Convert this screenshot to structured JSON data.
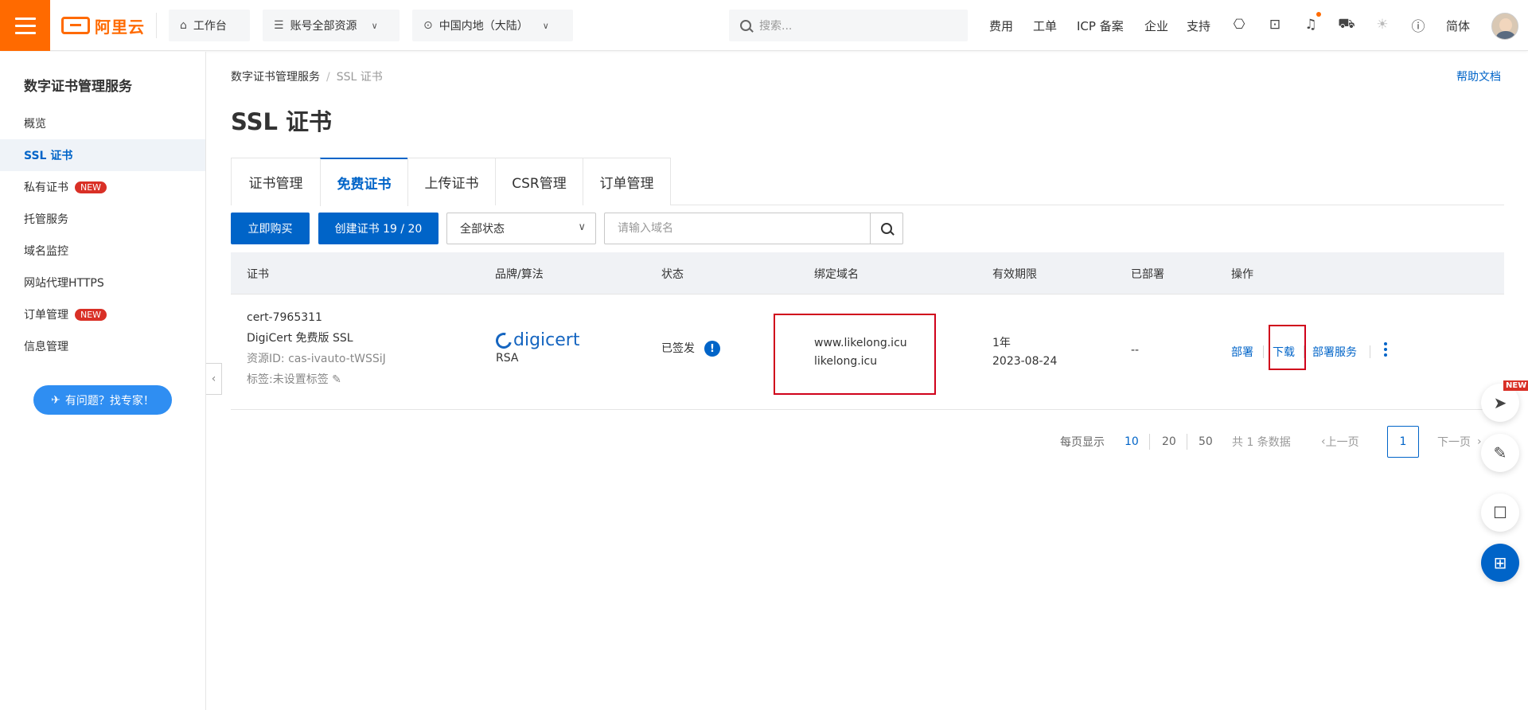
{
  "topbar": {
    "logo_text": "阿里云",
    "workbench": "工作台",
    "resources": "账号全部资源",
    "region": "中国内地（大陆）",
    "search_placeholder": "搜索...",
    "links": [
      "费用",
      "工单",
      "ICP 备案",
      "企业",
      "支持"
    ],
    "lang": "简体",
    "accent_color": "#ff6a00"
  },
  "sidebar": {
    "title": "数字证书管理服务",
    "items": [
      {
        "label": "概览"
      },
      {
        "label": "SSL 证书",
        "active": true
      },
      {
        "label": "私有证书",
        "badge": "NEW"
      },
      {
        "label": "托管服务"
      },
      {
        "label": "域名监控"
      },
      {
        "label": "网站代理HTTPS"
      },
      {
        "label": "订单管理",
        "badge": "NEW"
      },
      {
        "label": "信息管理"
      }
    ],
    "help_button": "有问题？找专家！"
  },
  "main": {
    "breadcrumb": [
      "数字证书管理服务",
      "SSL 证书"
    ],
    "help_doc": "帮助文档",
    "title": "SSL 证书",
    "tabs": [
      "证书管理",
      "免费证书",
      "上传证书",
      "CSR管理",
      "订单管理"
    ],
    "active_tab": "免费证书",
    "buy_button": "立即购买",
    "create_button": "创建证书 19 / 20",
    "status_select": "全部状态",
    "domain_placeholder": "请输入域名"
  },
  "table": {
    "headers": [
      "证书",
      "品牌/算法",
      "状态",
      "绑定域名",
      "有效期限",
      "已部署",
      "操作"
    ],
    "rows": [
      {
        "cert_id": "cert-7965311",
        "cert_name": "DigiCert 免费版 SSL",
        "resource_id": "资源ID: cas-ivauto-tWSSiJ",
        "tags": "标签:未设置标签",
        "brand": "digicert",
        "algorithm": "RSA",
        "status": "已签发",
        "domain1": "www.likelong.icu",
        "domain2": "likelong.icu",
        "validity": "1年",
        "expire": "2023-08-24",
        "deployed": "--",
        "actions": [
          "部署",
          "下载",
          "部署服务"
        ]
      }
    ]
  },
  "pagination": {
    "per_page_label": "每页显示",
    "sizes": [
      "10",
      "20",
      "50"
    ],
    "total": "共 1 条数据",
    "prev": "上一页",
    "current": "1",
    "next": "下一页"
  },
  "float": {
    "new_badge": "NEW"
  }
}
